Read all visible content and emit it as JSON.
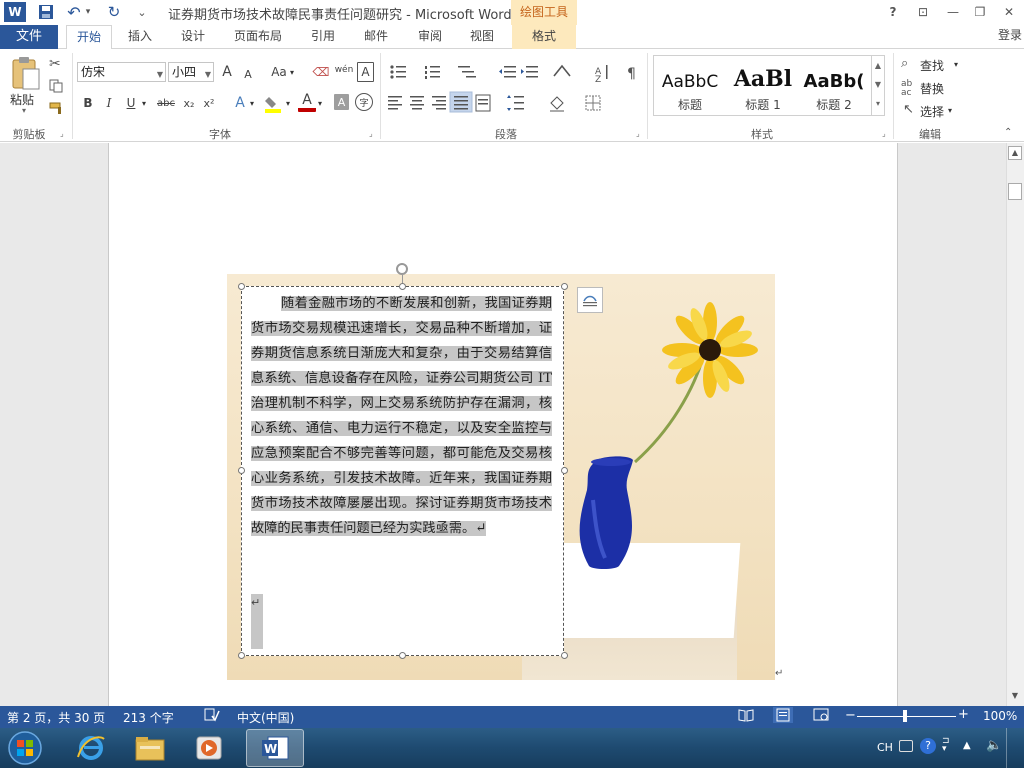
{
  "window": {
    "title": "证券期货市场技术故障民事责任问题研究 - Microsoft Word",
    "context_tab_group": "绘图工具",
    "help": "?",
    "restore_ribbon": "⊡",
    "minimize": "—",
    "maximize": "❐",
    "close": "✕"
  },
  "qat": {
    "undo": "↶",
    "redo": "↻",
    "more": "⌄"
  },
  "tabs": {
    "file": "文件",
    "items": [
      "开始",
      "插入",
      "设计",
      "页面布局",
      "引用",
      "邮件",
      "审阅",
      "视图"
    ],
    "format": "格式",
    "sign_in": "登录"
  },
  "ribbon": {
    "clipboard": {
      "paste": "粘贴",
      "label": "剪贴板"
    },
    "font": {
      "font_name": "仿宋",
      "font_size": "小四",
      "grow": "A",
      "shrink": "A",
      "change_case": "Aa",
      "phonetic": "wén",
      "char_border": "A",
      "bold": "B",
      "italic": "I",
      "underline": "U",
      "strike": "abc",
      "subscript": "x₂",
      "superscript": "x²",
      "effects": "A",
      "font_color": "A",
      "shading": "A",
      "enclose": "字",
      "label": "字体"
    },
    "paragraph": {
      "label": "段落"
    },
    "styles": {
      "label": "样式",
      "items": [
        {
          "sample": "AaBbC",
          "name": "标题"
        },
        {
          "sample": "AaBl",
          "name": "标题 1"
        },
        {
          "sample": "AaBb(",
          "name": "标题 2"
        }
      ]
    },
    "editing": {
      "find": "查找",
      "replace": "替换",
      "select": "选择",
      "label": "编辑"
    }
  },
  "document": {
    "textbox_text": "随着金融市场的不断发展和创新，我国证券期货市场交易规模迅速增长，交易品种不断增加，证券期货信息系统日渐庞大和复杂，由于交易结算信息系统、信息设备存在风险，证券公司期货公司 IT 治理机制不科学，网上交易系统防护存在漏洞，核心系统、通信、电力运行不稳定，以及安全监控与应急预案配合不够完善等问题，都可能危及交易核心业务系统，引发技术故障。近年来，我国证券期货市场技术故障屡屡出现。探讨证券期货市场技术故障的民事责任问题已经为实践亟需。",
    "para_mark": "↵"
  },
  "status": {
    "page": "第 2 页，共 30 页",
    "words": "213 个字",
    "language": "中文(中国)",
    "zoom": "100%",
    "zoom_minus": "−",
    "zoom_plus": "+"
  },
  "taskbar": {
    "ime": "CH"
  },
  "colors": {
    "accent": "#2b579a",
    "context": "#fde9bd",
    "context_text": "#c5641b"
  }
}
